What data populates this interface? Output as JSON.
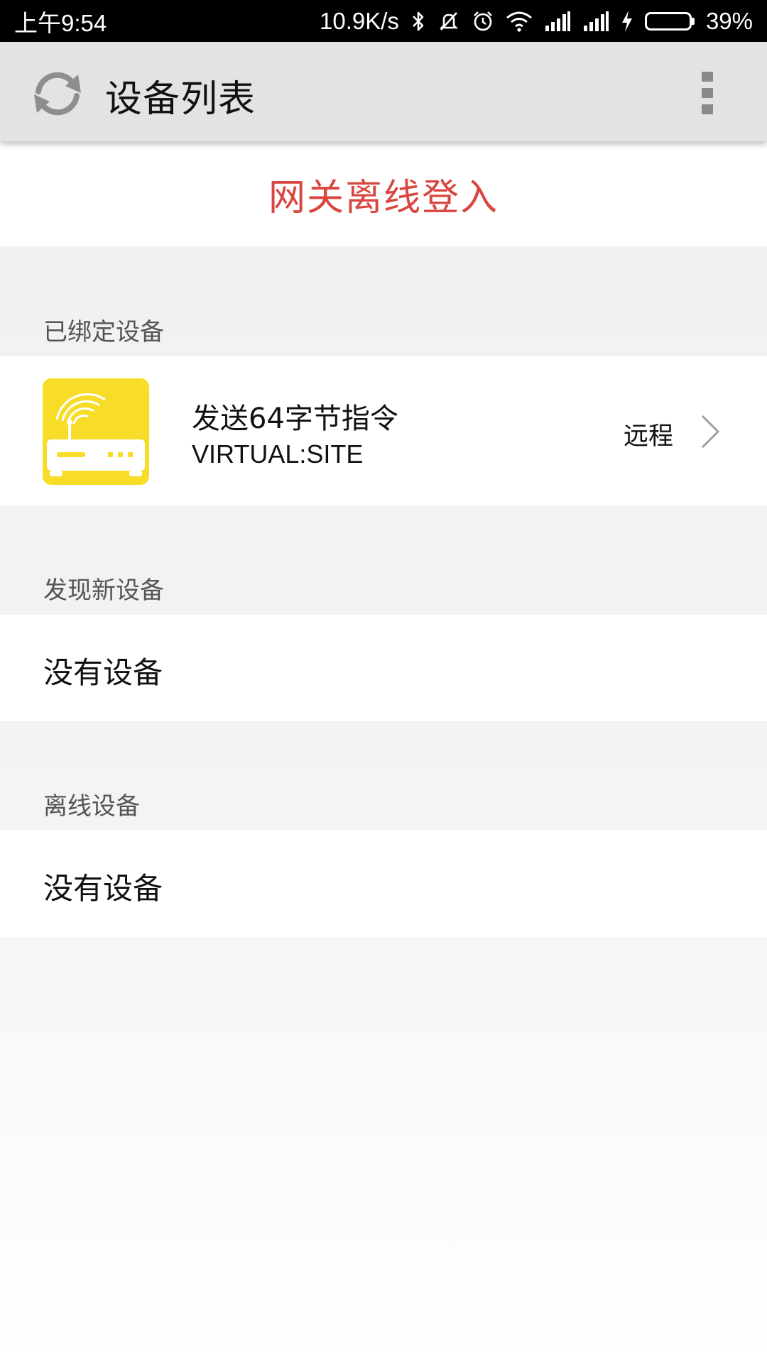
{
  "status_bar": {
    "time": "上午9:54",
    "net_speed": "10.9K/s",
    "battery_percent": "39%",
    "battery_level": 0.39,
    "icons": [
      "bluetooth-icon",
      "mute-icon",
      "alarm-icon",
      "wifi-icon",
      "signal-icon",
      "signal-icon",
      "charging-icon",
      "battery-icon"
    ]
  },
  "app_bar": {
    "title": "设备列表",
    "left_icon": "refresh-icon",
    "right_icon": "more-vert-icon"
  },
  "banner": {
    "text": "网关离线登入",
    "color": "#d9463f"
  },
  "sections": {
    "bound": {
      "header": "已绑定设备",
      "devices": [
        {
          "name": "发送64字节指令",
          "id": "VIRTUAL:SITE",
          "mode": "远程",
          "icon": "router-icon",
          "icon_bg": "#f8dd28"
        }
      ]
    },
    "new": {
      "header": "发现新设备",
      "empty_text": "没有设备"
    },
    "offline": {
      "header": "离线设备",
      "empty_text": "没有设备"
    }
  }
}
